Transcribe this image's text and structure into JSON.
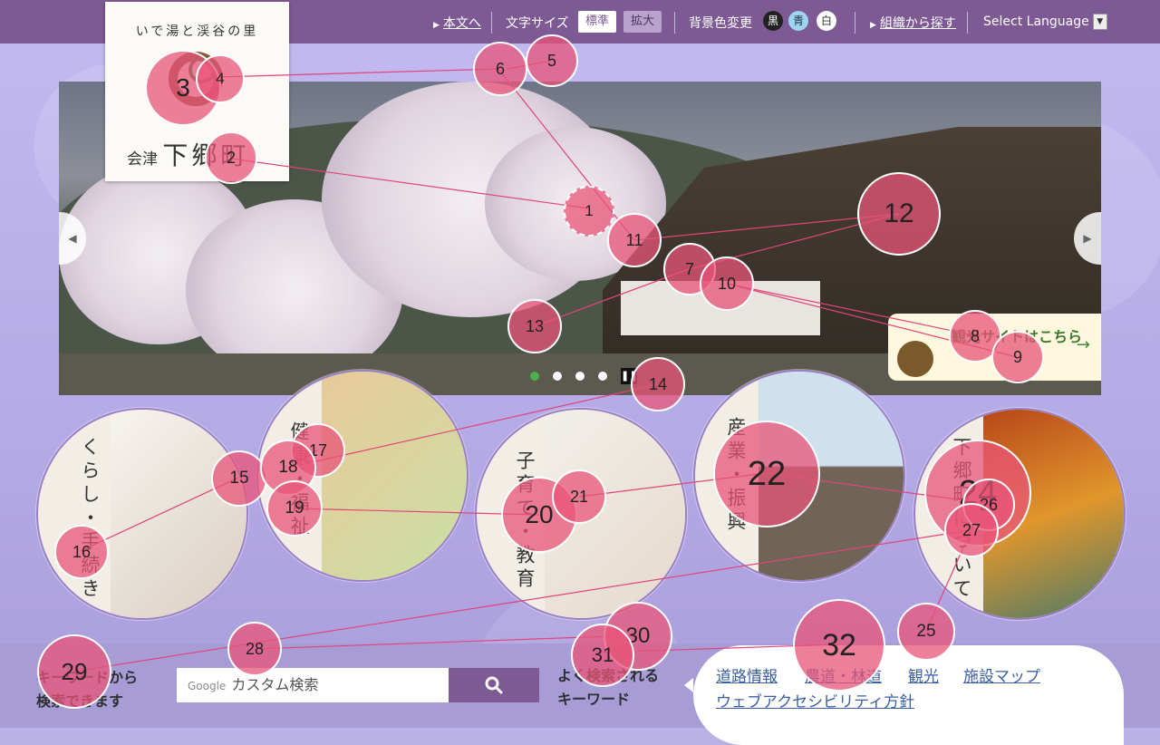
{
  "topbar": {
    "skip_link": "本文へ",
    "text_size_label": "文字サイズ",
    "size_standard": "標準",
    "size_large": "拡大",
    "bg_color_label": "背景色変更",
    "bg_black": "黒",
    "bg_blue": "青",
    "bg_white": "白",
    "org_search": "組織から探す",
    "select_language": "Select Language"
  },
  "logo": {
    "tagline": "いで湯と渓谷の里",
    "prefix": "会津",
    "name": "下郷町"
  },
  "hero": {
    "banner_text": "観光サイトはこちら",
    "banner_arrow": "→",
    "pause_icon": "❚❚"
  },
  "categories": [
    {
      "label": "くらし・手続き"
    },
    {
      "label": "健康・福祉"
    },
    {
      "label": "子育て・教育"
    },
    {
      "label": "産業・振興"
    },
    {
      "label": "下郷町について"
    }
  ],
  "search": {
    "label_line1": "キーワードから",
    "label_line2": "検索できます",
    "google_brand": "Google",
    "placeholder": "カスタム検索",
    "button_icon": "search-icon"
  },
  "keywords": {
    "label_line1": "よく検索される",
    "label_line2": "キーワード",
    "items": [
      "道路情報",
      "農道・林道",
      "観光",
      "施設マップ",
      "ウェブアクセシビリティ方針"
    ]
  },
  "markers": [
    "1",
    "2",
    "3",
    "4",
    "5",
    "6",
    "7",
    "8",
    "9",
    "10",
    "11",
    "12",
    "13",
    "14",
    "15",
    "16",
    "17",
    "18",
    "19",
    "20",
    "21",
    "22",
    "24",
    "25",
    "26",
    "27",
    "28",
    "29",
    "30",
    "31",
    "32"
  ],
  "colors": {
    "topbar": "#7e5a95",
    "background": "#b9b0e6",
    "marker": "#e85478",
    "link": "#3b5fa5"
  }
}
